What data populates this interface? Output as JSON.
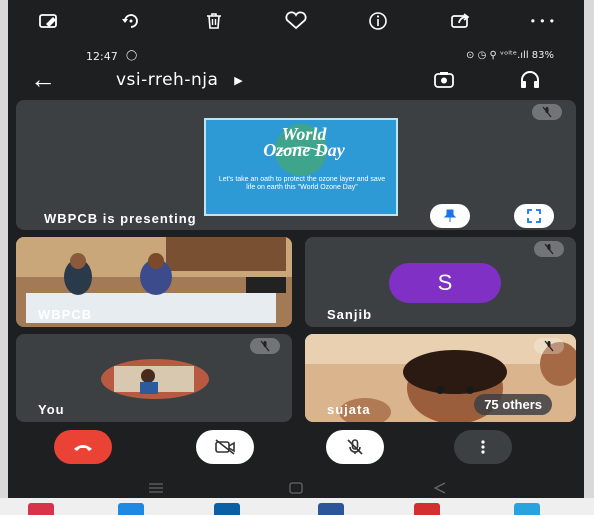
{
  "toolbar": {
    "icons": [
      "edit-icon",
      "rotate-icon",
      "trash-icon",
      "heart-icon",
      "info-icon",
      "share-icon",
      "more-icon"
    ],
    "more_label": "• • •"
  },
  "status": {
    "time": "12:47",
    "right": "⊙ ◷ ⚲ ᵛᵒˡᵗᵉ.ıll 83%"
  },
  "meeting": {
    "back_glyph": "←",
    "title": "vsi-rreh-nja",
    "caret": "▶"
  },
  "presentation": {
    "label": "WBPCB is presenting",
    "poster_title": "World Ozone Day",
    "poster_text": "Let's take an oath to protect the ozone layer and save life on earth this \"World Ozone Day\""
  },
  "tiles": {
    "wbpcb_label": "WBPCB",
    "sanjib_label": "Sanjib",
    "sanjib_initial": "S",
    "you_label": "You",
    "sujata_label": "sujata",
    "others_label": "75 others"
  },
  "colors": {
    "end_call": "#ea4335",
    "avatar": "#8130c6",
    "tile": "#3c4043",
    "poster": "#2d9ad6"
  }
}
